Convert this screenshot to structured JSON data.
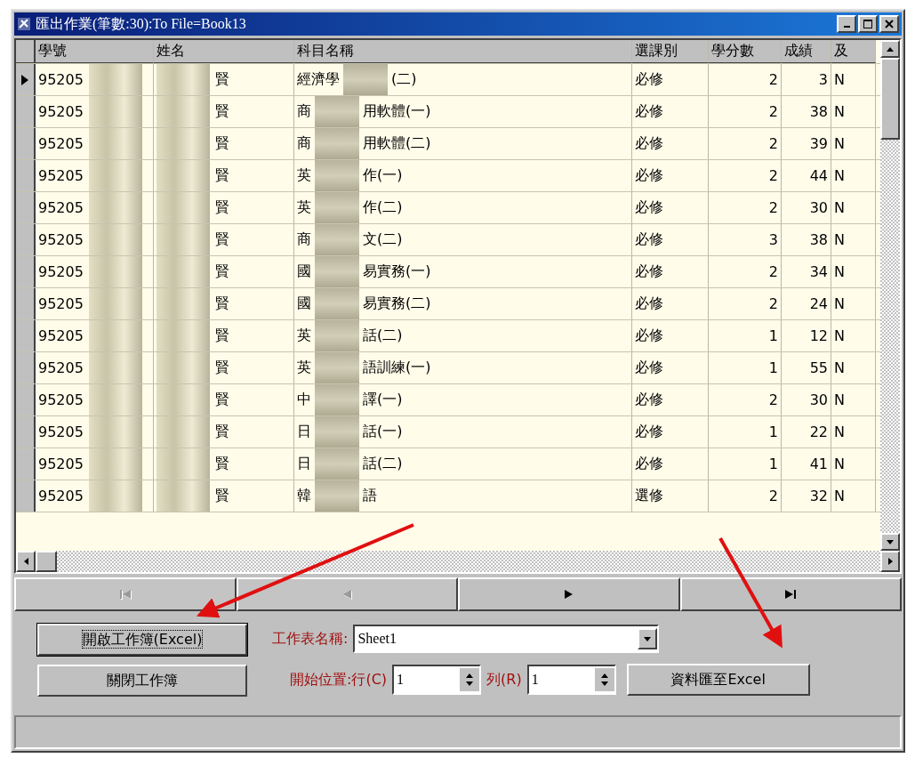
{
  "window": {
    "title": "匯出作業(筆數:30):To File=Book13"
  },
  "table": {
    "columns": [
      "學號",
      "姓名",
      "科目名稱",
      "選課別",
      "學分數",
      "成績",
      "及"
    ],
    "rows": [
      {
        "selected": true,
        "id": "95205",
        "name": "賢",
        "course_start": "經濟學",
        "course_end": "(二)",
        "type": "必修",
        "credits": "2",
        "score": "3",
        "pass": "N"
      },
      {
        "selected": false,
        "id": "95205",
        "name": "賢",
        "course_start": "商",
        "course_end": "用軟體(一)",
        "type": "必修",
        "credits": "2",
        "score": "38",
        "pass": "N"
      },
      {
        "selected": false,
        "id": "95205",
        "name": "賢",
        "course_start": "商",
        "course_end": "用軟體(二)",
        "type": "必修",
        "credits": "2",
        "score": "39",
        "pass": "N"
      },
      {
        "selected": false,
        "id": "95205",
        "name": "賢",
        "course_start": "英",
        "course_end": "作(一)",
        "type": "必修",
        "credits": "2",
        "score": "44",
        "pass": "N"
      },
      {
        "selected": false,
        "id": "95205",
        "name": "賢",
        "course_start": "英",
        "course_end": "作(二)",
        "type": "必修",
        "credits": "2",
        "score": "30",
        "pass": "N"
      },
      {
        "selected": false,
        "id": "95205",
        "name": "賢",
        "course_start": "商",
        "course_end": "文(二)",
        "type": "必修",
        "credits": "3",
        "score": "38",
        "pass": "N"
      },
      {
        "selected": false,
        "id": "95205",
        "name": "賢",
        "course_start": "國",
        "course_end": "易實務(一)",
        "type": "必修",
        "credits": "2",
        "score": "34",
        "pass": "N"
      },
      {
        "selected": false,
        "id": "95205",
        "name": "賢",
        "course_start": "國",
        "course_end": "易實務(二)",
        "type": "必修",
        "credits": "2",
        "score": "24",
        "pass": "N"
      },
      {
        "selected": false,
        "id": "95205",
        "name": "賢",
        "course_start": "英",
        "course_end": "話(二)",
        "type": "必修",
        "credits": "1",
        "score": "12",
        "pass": "N"
      },
      {
        "selected": false,
        "id": "95205",
        "name": "賢",
        "course_start": "英",
        "course_end": "語訓練(一)",
        "type": "必修",
        "credits": "1",
        "score": "55",
        "pass": "N"
      },
      {
        "selected": false,
        "id": "95205",
        "name": "賢",
        "course_start": "中",
        "course_end": "譯(一)",
        "type": "必修",
        "credits": "2",
        "score": "30",
        "pass": "N"
      },
      {
        "selected": false,
        "id": "95205",
        "name": "賢",
        "course_start": "日",
        "course_end": "話(一)",
        "type": "必修",
        "credits": "1",
        "score": "22",
        "pass": "N"
      },
      {
        "selected": false,
        "id": "95205",
        "name": "賢",
        "course_start": "日",
        "course_end": "話(二)",
        "type": "必修",
        "credits": "1",
        "score": "41",
        "pass": "N"
      },
      {
        "selected": false,
        "id": "95205",
        "name": "賢",
        "course_start": "韓",
        "course_end": "語",
        "type": "選修",
        "credits": "2",
        "score": "32",
        "pass": "N"
      }
    ]
  },
  "navigator": [
    {
      "kind": "first",
      "disabled": true
    },
    {
      "kind": "prev",
      "disabled": true
    },
    {
      "kind": "next",
      "disabled": false
    },
    {
      "kind": "last",
      "disabled": false
    }
  ],
  "open_button": {
    "label": "開啟工作簿(Excel)",
    "focused": true
  },
  "close_button": {
    "label": "關閉工作簿",
    "focused": false
  },
  "sheet_label": "工作表名稱:",
  "sheet_select": {
    "value": "Sheet1"
  },
  "start_label": "開始位置:行(C)",
  "row_spin": {
    "value": "1"
  },
  "col_label": "列(R)",
  "col_spin": {
    "value": "1"
  },
  "export_button": {
    "label": "資料匯至Excel",
    "focused": false
  }
}
